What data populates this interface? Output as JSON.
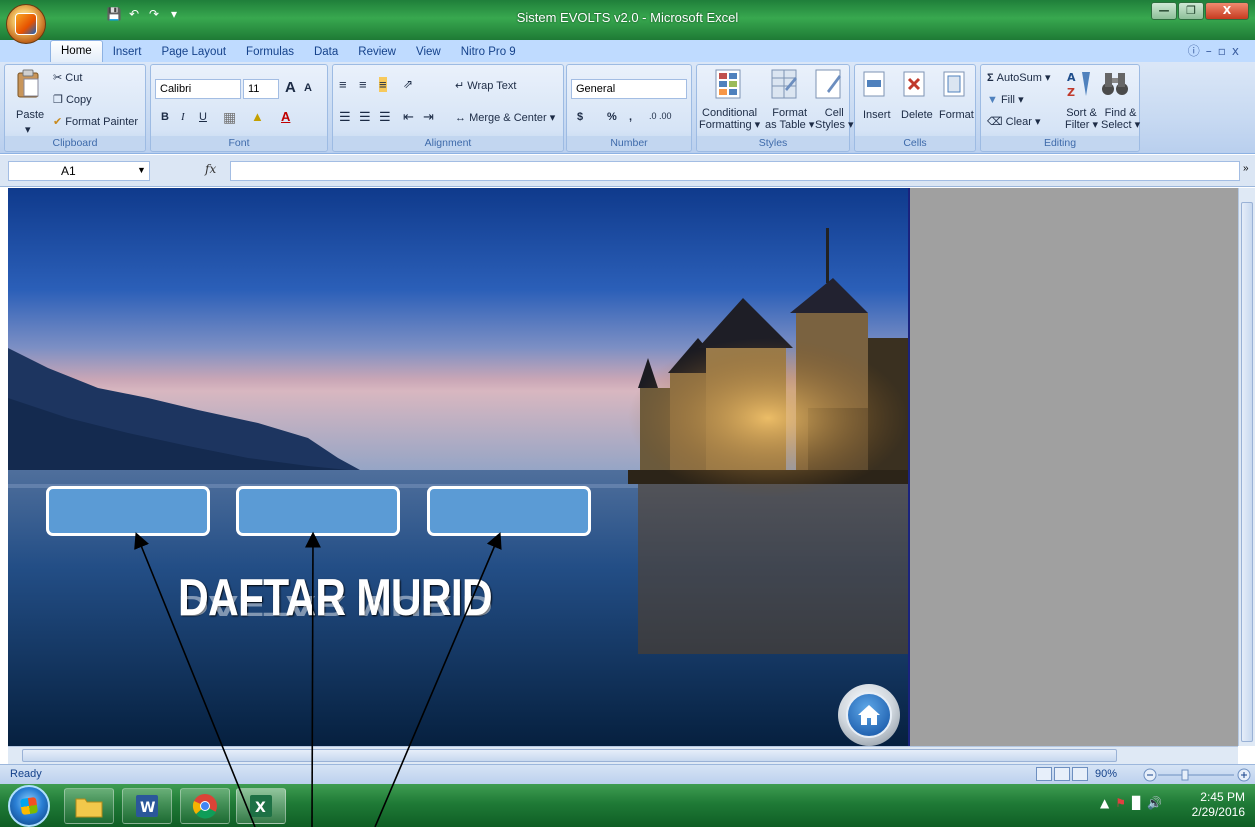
{
  "window": {
    "title": "Sistem EVOLTS v2.0 - Microsoft Excel",
    "controls": [
      "minimize",
      "restore",
      "close"
    ]
  },
  "ribbon_tabs": [
    "Home",
    "Insert",
    "Page Layout",
    "Formulas",
    "Data",
    "Review",
    "View",
    "Nitro Pro 9"
  ],
  "active_tab": "Home",
  "ribbon": {
    "clipboard": {
      "label": "Clipboard",
      "paste": "Paste",
      "cut": "Cut",
      "copy": "Copy",
      "format_painter": "Format Painter"
    },
    "font": {
      "label": "Font",
      "name": "Calibri",
      "size": "11",
      "bold": "B",
      "italic": "I",
      "underline": "U",
      "grow": "A",
      "shrink": "A"
    },
    "alignment": {
      "label": "Alignment",
      "wrap_text": "Wrap Text",
      "merge_center": "Merge & Center"
    },
    "number": {
      "label": "Number",
      "format": "General",
      "currency": "$",
      "percent": "%",
      "comma": ",",
      "inc_dec": ".0 .00"
    },
    "styles": {
      "label": "Styles",
      "conditional_1": "Conditional",
      "conditional_2": "Formatting",
      "format_table_1": "Format",
      "format_table_2": "as Table",
      "cell_styles_1": "Cell",
      "cell_styles_2": "Styles"
    },
    "cells": {
      "label": "Cells",
      "insert": "Insert",
      "delete": "Delete",
      "format": "Format"
    },
    "editing": {
      "label": "Editing",
      "autosum": "AutoSum",
      "fill": "Fill",
      "clear": "Clear",
      "sort_1": "Sort &",
      "sort_2": "Filter",
      "find_1": "Find &",
      "find_2": "Select"
    }
  },
  "formula_bar": {
    "name_box": "A1",
    "fx": "fx",
    "value": ""
  },
  "sheet": {
    "heading": "DAFTAR MURID",
    "buttons": [
      "",
      "",
      ""
    ],
    "colors": {
      "button_fill": "#5b9bd5",
      "button_border": "#ffffff",
      "side_panel": "#a0a0a0"
    }
  },
  "status_bar": {
    "status": "Ready",
    "zoom": "90%"
  },
  "taskbar": {
    "apps": [
      "file-explorer",
      "word",
      "chrome",
      "excel"
    ],
    "time": "2:45 PM",
    "date": "2/29/2016"
  },
  "colors": {
    "title_bar": "#2e9a4a",
    "ribbon": "#c8daf2",
    "taskbar": "#1f7a36"
  }
}
